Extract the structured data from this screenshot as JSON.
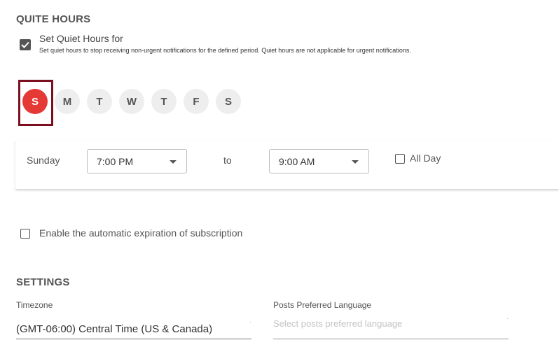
{
  "quiet_hours": {
    "title": "QUITE HOURS",
    "checkbox_label": "Set Quiet Hours for",
    "description": "Set quiet hours to stop receiving non-urgent notifications for the defined period. Quiet hours are not applicable for urgent notifications.",
    "checked": true,
    "days": [
      "S",
      "M",
      "T",
      "W",
      "T",
      "F",
      "S"
    ],
    "selected_day_index": 0,
    "schedule": {
      "day_label": "Sunday",
      "start_time": "7:00 PM",
      "to_label": "to",
      "end_time": "9:00 AM",
      "all_day_label": "All Day"
    }
  },
  "expiration": {
    "label": "Enable the automatic expiration of subscription"
  },
  "settings": {
    "title": "SETTINGS",
    "timezone_label": "Timezone",
    "timezone_value": "(GMT-06:00) Central Time (US & Canada)",
    "language_label": "Posts Preferred Language",
    "language_placeholder": "Select posts preferred language"
  },
  "colors": {
    "selected_day": "#e53935",
    "highlight_box": "#7b0f1f"
  }
}
